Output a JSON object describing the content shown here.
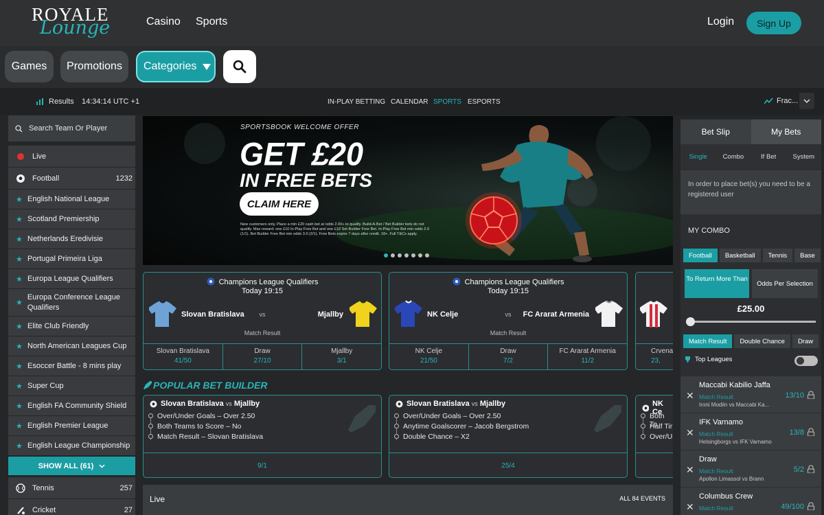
{
  "header": {
    "logo_top": "ROYALE",
    "logo_bottom": "Lounge",
    "nav": [
      "Casino",
      "Sports"
    ],
    "login": "Login",
    "signup": "Sign Up"
  },
  "categories": {
    "games": "Games",
    "promotions": "Promotions",
    "categories": "Categories"
  },
  "sportsbar": {
    "results": "Results",
    "time": "14:34:14 UTC +1",
    "tabs": [
      "IN-PLAY BETTING",
      "CALENDAR",
      "SPORTS",
      "ESPORTS"
    ],
    "active_tab": "SPORTS",
    "odds_format": "Frac..."
  },
  "sidebar": {
    "search_placeholder": "Search Team Or Player",
    "live": "Live",
    "football": {
      "label": "Football",
      "count": "1232"
    },
    "leagues": [
      "English National League",
      "Scotland Premiership",
      "Netherlands Eredivisie",
      "Portugal Primeira Liga",
      "Europa League Qualifiers",
      "Europa Conference League Qualifiers",
      "Elite Club Friendly",
      "North American Leagues Cup",
      "Esoccer Battle - 8 mins play",
      "Super Cup",
      "English FA Community Shield",
      "English Premier League",
      "English League Championship"
    ],
    "show_all": "SHOW ALL (61)",
    "tennis": {
      "label": "Tennis",
      "count": "257"
    },
    "cricket": {
      "label": "Cricket",
      "count": "27"
    }
  },
  "banner": {
    "subtitle": "SPORTSBOOK WELCOME OFFER",
    "headline1": "GET £20",
    "headline2": "IN FREE BETS",
    "cta": "CLAIM HERE",
    "terms": "New customers only. Place a min £20 cash bet at odds 2.00+ to qualify. Build-A-Bet / Bet Builder bets do not qualify. Max reward: one £10 In-Play Free Bet and one £10 Set Builder Free Bet. In-Play Free Bet min odds 2.0 (1/1). Bet Builder Free Bet min odds 3.0 (2/1). Free Bets expire 7 days after credit. 18+. Full T&Cs apply."
  },
  "matches": [
    {
      "league": "Champions League Qualifiers",
      "time": "Today 19:15",
      "home": "Slovan Bratislava",
      "vs": "vs",
      "away": "Mjallby",
      "market": "Match Result",
      "odds": [
        {
          "name": "Slovan Bratislava",
          "price": "41/50"
        },
        {
          "name": "Draw",
          "price": "27/10"
        },
        {
          "name": "Mjallby",
          "price": "3/1"
        }
      ]
    },
    {
      "league": "Champions League Qualifiers",
      "time": "Today 19:15",
      "home": "NK Celje",
      "vs": "vs",
      "away": "FC Ararat Armenia",
      "market": "Match Result",
      "odds": [
        {
          "name": "NK Celje",
          "price": "21/50"
        },
        {
          "name": "Draw",
          "price": "7/2"
        },
        {
          "name": "FC Ararat Armenia",
          "price": "11/2"
        }
      ]
    },
    {
      "name3": "Crvena",
      "price3": "23,"
    }
  ],
  "popular": {
    "title": "POPULAR BET BUILDER",
    "cards": [
      {
        "home": "Slovan Bratislava",
        "vs": "vs",
        "away": "Mjallby",
        "selections": [
          "Over/Under Goals – Over 2.50",
          "Both Teams to Score – No",
          "Match Result – Slovan Bratislava"
        ],
        "odds": "9/1"
      },
      {
        "home": "Slovan Bratislava",
        "vs": "vs",
        "away": "Mjallby",
        "selections": [
          "Over/Under Goals – Over 2.50",
          "Anytime Goalscorer – Jacob Bergstrom",
          "Double Chance – X2"
        ],
        "odds": "25/4"
      },
      {
        "home": "NK Ce",
        "selections": [
          "Both Te",
          "Half Tir",
          "Over/Ur"
        ]
      }
    ]
  },
  "live": {
    "label": "Live",
    "all_events": "ALL 84 EVENTS"
  },
  "betslip": {
    "tabs": [
      "Bet Slip",
      "My Bets"
    ],
    "subtabs": [
      "Single",
      "Combo",
      "If Bet",
      "System"
    ],
    "message": "In order to place bet(s) you need to be a registered user",
    "my_combo": "MY COMBO",
    "sports": [
      "Football",
      "Basketball",
      "Tennis",
      "Base"
    ],
    "return_more": "To Return More Than",
    "odds_per_selection": "Odds Per Selection",
    "amount": "£25.00",
    "markets": [
      "Match Result",
      "Double Chance",
      "Draw"
    ],
    "top_leagues": "Top Leagues",
    "selections": [
      {
        "name": "Maccabi Kabilio Jaffa",
        "market": "Match Result",
        "event": "Ironi Modiin vs Maccabi Ka...",
        "odds": "13/10"
      },
      {
        "name": "IFK Varnamo",
        "market": "Match Result",
        "event": "Helsingborgs vs IFK Varnamo",
        "odds": "13/8"
      },
      {
        "name": "Draw",
        "market": "Match Result",
        "event": "Apollon Limassol vs Brann",
        "odds": "5/2"
      },
      {
        "name": "Columbus Crew",
        "market": "Match Result",
        "event": "",
        "odds": "49/100"
      }
    ]
  },
  "colors": {
    "accent": "#1b9ea3",
    "accent_text": "#2ab3b8",
    "background": "#242628"
  }
}
